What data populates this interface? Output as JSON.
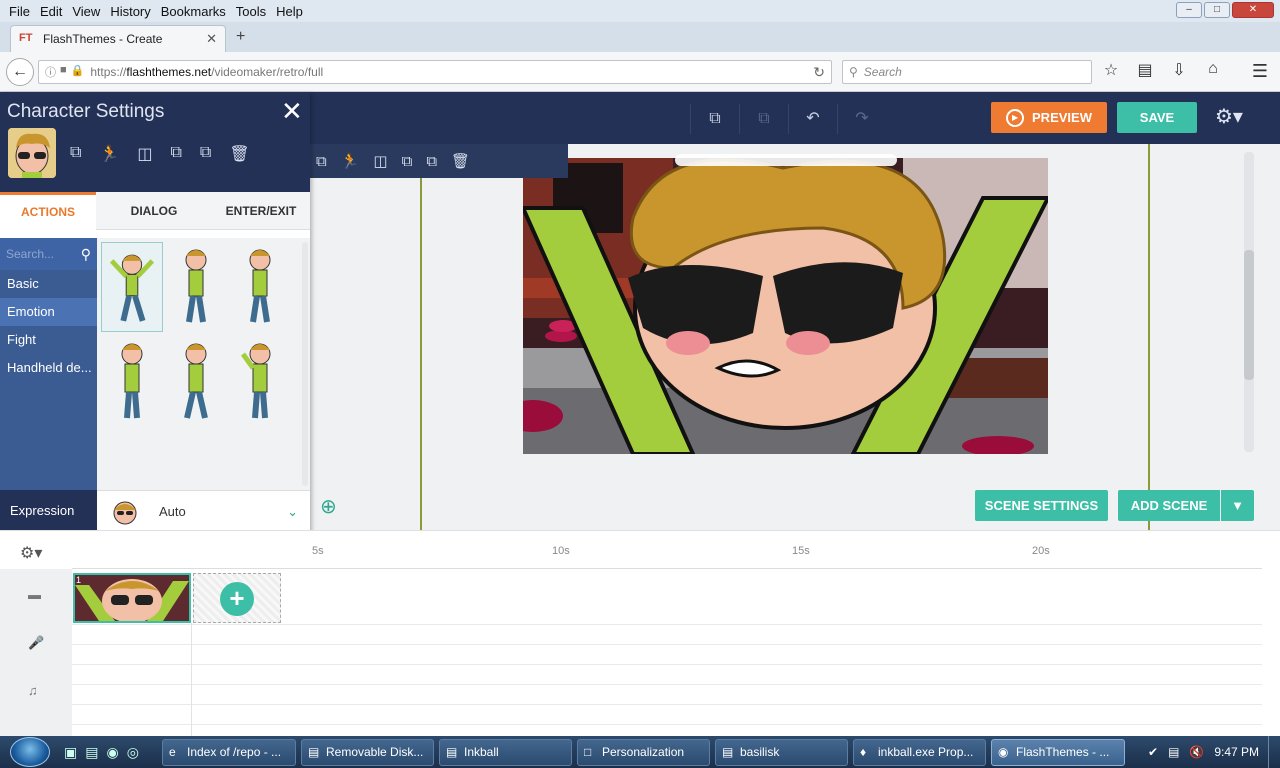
{
  "browser": {
    "menu": [
      "File",
      "Edit",
      "View",
      "History",
      "Bookmarks",
      "Tools",
      "Help"
    ],
    "tab_title": "FlashThemes - Create",
    "url_prefix": "https://",
    "url_host": "flashthemes.net",
    "url_path": "/videomaker/retro/full",
    "search_placeholder": "Search"
  },
  "toolbar": {
    "preview_label": "PREVIEW",
    "save_label": "SAVE"
  },
  "character_panel": {
    "title": "Character Settings",
    "tabs": [
      {
        "label": "ACTIONS",
        "active": true
      },
      {
        "label": "DIALOG",
        "active": false
      },
      {
        "label": "ENTER/EXIT",
        "active": false
      }
    ],
    "search_placeholder": "Search...",
    "categories": [
      {
        "label": "Basic",
        "selected": false
      },
      {
        "label": "Emotion",
        "selected": true
      },
      {
        "label": "Fight",
        "selected": false
      },
      {
        "label": "Handheld de...",
        "selected": false
      }
    ],
    "expression_label": "Expression",
    "expression_value": "Auto"
  },
  "stage": {
    "scene_settings_label": "SCENE SETTINGS",
    "add_scene_label": "ADD SCENE"
  },
  "timeline": {
    "ticks": [
      "5s",
      "10s",
      "15s",
      "20s"
    ],
    "scene_number": "1"
  },
  "taskbar": {
    "tasks": [
      {
        "label": "Index of /repo - ...",
        "active": false
      },
      {
        "label": "Removable Disk...",
        "active": false
      },
      {
        "label": "Inkball",
        "active": false
      },
      {
        "label": "Personalization",
        "active": false
      },
      {
        "label": "basilisk",
        "active": false
      },
      {
        "label": "inkball.exe Prop...",
        "active": false
      },
      {
        "label": "FlashThemes - ...",
        "active": true
      }
    ],
    "clock": "9:47 PM"
  },
  "colors": {
    "navy": "#233157",
    "teal": "#3dbea6",
    "orange": "#ef7a32"
  }
}
